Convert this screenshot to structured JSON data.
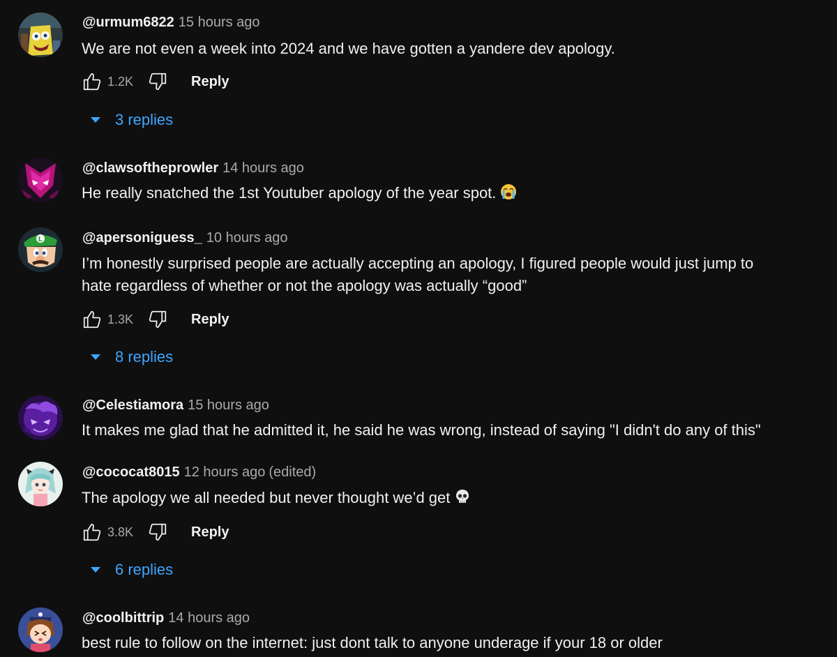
{
  "colors": {
    "background": "#0f0f0f",
    "text": "#f1f1f1",
    "secondary_text": "#aaaaaa",
    "link_blue": "#3ea6ff"
  },
  "reply_label": "Reply",
  "comments": [
    {
      "author": "@urmum6822",
      "time": "15 hours ago",
      "text": "We are not even a week into 2024 and we have gotten a yandere dev apology.",
      "likes": "1.2K",
      "replies": "3 replies",
      "avatar_icon": "spongebob-avatar-icon"
    },
    {
      "author": "@clawsoftheprowler",
      "time": "14 hours ago",
      "text": "He really snatched the 1st Youtuber apology of the year spot.",
      "emoji": "loudly-crying-face-emoji",
      "avatar_icon": "masked-character-avatar-icon"
    },
    {
      "author": "@apersoniguess_",
      "time": "10 hours ago",
      "text_line1": "I’m honestly surprised people are actually accepting an apology, I figured people would just jump to",
      "text_line2": "hate regardless of whether or not the apology was actually “good”",
      "likes": "1.3K",
      "replies": "8 replies",
      "avatar_icon": "luigi-avatar-icon"
    },
    {
      "author": "@Celestiamora",
      "time": "15 hours ago",
      "text": "It makes me glad that he admitted it, he said he was wrong, instead of saying \"I didn't do any of this\"",
      "avatar_icon": "purple-character-avatar-icon"
    },
    {
      "author": "@cococat8015",
      "time": "12 hours ago",
      "edited": "(edited)",
      "text": "The apology we all needed but never thought we’d get",
      "emoji": "skull-emoji",
      "likes": "3.8K",
      "replies": "6 replies",
      "avatar_icon": "anime-girl-avatar-icon"
    },
    {
      "author": "@coolbittrip",
      "time": "14 hours ago",
      "text": "best rule to follow on the internet: just dont talk to anyone underage if your 18 or older",
      "avatar_icon": "cartoon-child-avatar-icon"
    }
  ]
}
